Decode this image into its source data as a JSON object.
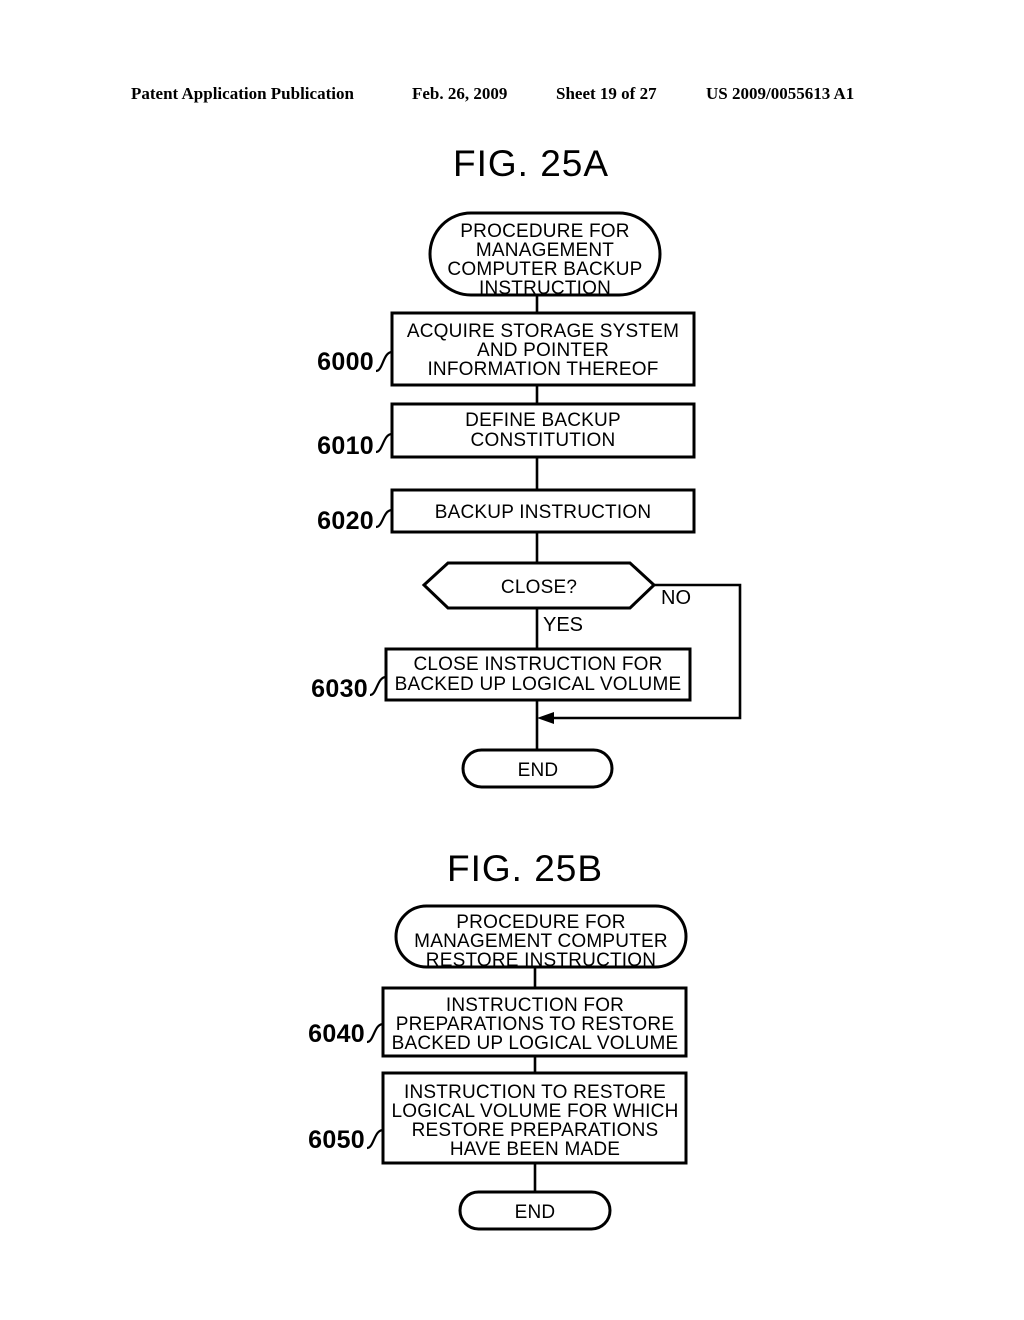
{
  "header": {
    "publication": "Patent Application Publication",
    "date": "Feb. 26, 2009",
    "sheet": "Sheet 19 of 27",
    "number": "US 2009/0055613 A1"
  },
  "figures": [
    {
      "title": "FIG. 25A",
      "start_node": {
        "shape": "terminator",
        "lines": [
          "PROCEDURE FOR",
          "MANAGEMENT",
          "COMPUTER BACKUP",
          "INSTRUCTION"
        ]
      },
      "steps": [
        {
          "ref": "6000",
          "shape": "process",
          "lines": [
            "ACQUIRE STORAGE SYSTEM",
            "AND POINTER",
            "INFORMATION THEREOF"
          ]
        },
        {
          "ref": "6010",
          "shape": "process",
          "lines": [
            "DEFINE BACKUP",
            "CONSTITUTION"
          ]
        },
        {
          "ref": "6020",
          "shape": "process",
          "lines": [
            "BACKUP INSTRUCTION"
          ]
        },
        {
          "ref": "",
          "shape": "decision",
          "lines": [
            "CLOSE?"
          ],
          "branch_yes": "YES",
          "branch_no": "NO"
        },
        {
          "ref": "6030",
          "shape": "process",
          "lines": [
            "CLOSE INSTRUCTION FOR",
            "BACKED UP LOGICAL VOLUME"
          ]
        }
      ],
      "end_node": {
        "shape": "terminator",
        "lines": [
          "END"
        ]
      }
    },
    {
      "title": "FIG. 25B",
      "start_node": {
        "shape": "terminator",
        "lines": [
          "PROCEDURE FOR",
          "MANAGEMENT COMPUTER",
          "RESTORE INSTRUCTION"
        ]
      },
      "steps": [
        {
          "ref": "6040",
          "shape": "process",
          "lines": [
            "INSTRUCTION FOR",
            "PREPARATIONS TO RESTORE",
            "BACKED UP LOGICAL VOLUME"
          ]
        },
        {
          "ref": "6050",
          "shape": "process",
          "lines": [
            "INSTRUCTION TO RESTORE",
            "LOGICAL VOLUME FOR WHICH",
            "RESTORE PREPARATIONS",
            "HAVE BEEN MADE"
          ]
        }
      ],
      "end_node": {
        "shape": "terminator",
        "lines": [
          "END"
        ]
      }
    }
  ],
  "colors": {
    "ink": "#000000",
    "paper": "#ffffff"
  }
}
